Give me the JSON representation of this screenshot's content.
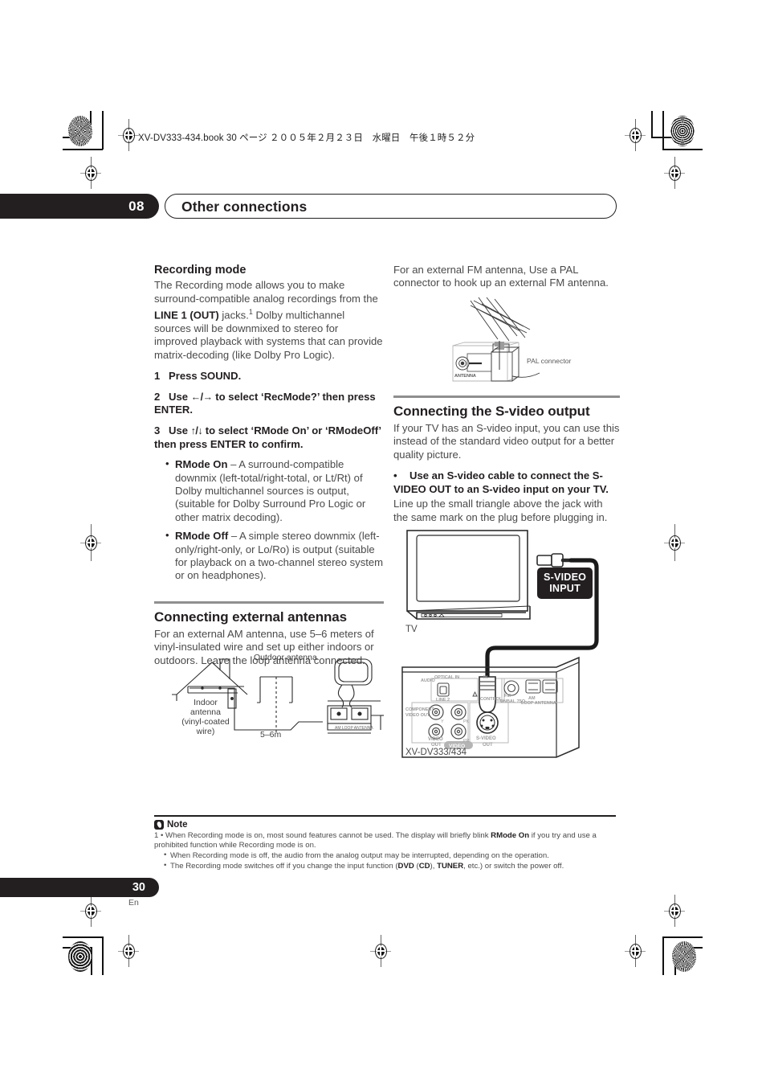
{
  "document": {
    "file_header": "XV-DV333-434.book  30 ページ  ２００５年２月２３日　水曜日　午後１時５２分",
    "chapter_number": "08",
    "chapter_title": "Other connections",
    "page_number": "30",
    "page_language": "En"
  },
  "left_column": {
    "recording_mode": {
      "heading": "Recording mode",
      "intro_1": "The Recording mode allows you to make surround-compatible analog recordings from the ",
      "intro_bold": "LINE 1 (OUT)",
      "intro_2": " jacks.",
      "intro_footnote": "1",
      "intro_3": " Dolby multichannel sources will be downmixed to stereo for improved playback with systems that can provide matrix-decoding (like Dolby Pro Logic).",
      "step1_num": "1",
      "step1_text": "Press SOUND.",
      "step2_num": "2",
      "step2_text_a": "Use ",
      "step2_arrows": "←/→",
      "step2_text_b": " to select ‘RecMode?’ then press ENTER.",
      "step3_num": "3",
      "step3_text_a": "Use ",
      "step3_arrows": "↑/↓",
      "step3_text_b": " to select ‘RMode On’ or ‘RModeOff’ then press ENTER to confirm.",
      "bullets": [
        {
          "term": "RMode On",
          "desc": " – A surround-compatible downmix (left-total/right-total, or Lt/Rt) of Dolby multichannel sources is output, (suitable for Dolby Surround Pro Logic or other matrix decoding)."
        },
        {
          "term": "RMode Off",
          "desc": " – A simple stereo downmix (left-only/right-only, or Lo/Ro) is output (suitable for playback on a two-channel stereo system or on headphones)."
        }
      ]
    },
    "external_antennas": {
      "heading": "Connecting external antennas",
      "body": "For an external AM antenna, use 5–6 meters of vinyl-insulated wire and set up either indoors or outdoors. Leave the loop antenna connected.",
      "figure": {
        "label_outdoor": "Outdoor antenna",
        "label_indoor": "Indoor antenna (vinyl-coated wire)",
        "label_length": "5–6m"
      }
    }
  },
  "right_column": {
    "fm_antenna": {
      "body": "For an external FM antenna, Use a PAL connector to hook up an external FM antenna.",
      "figure": {
        "label_pal": "PAL connector",
        "label_antenna_jack": "ANTENNA"
      }
    },
    "s_video": {
      "heading": "Connecting the S-video output",
      "body": "If your TV has an S-video input, you can use this instead of the standard video output for a better quality picture.",
      "bullet_bold": "Use an S-video cable to connect the S-VIDEO OUT to an S-video input on your TV.",
      "bullet_rest": "Line up the small triangle above the jack with the same mark on the plug before plugging in.",
      "figure": {
        "badge_line1": "S-VIDEO",
        "badge_line2": "INPUT",
        "label_tv": "TV",
        "label_model": "XV-DV333/434",
        "rear_labels": {
          "audio": "AUDIO",
          "optical_in": "OPTICAL IN",
          "line2": "LINE 2",
          "in": "IN",
          "control": "CONTROL",
          "component_video_out": "COMPONENT VIDEO OUT",
          "y": "Y",
          "pb": "Pв",
          "pr": "Pᴿ",
          "video_out": "VIDEO OUT",
          "video": "VIDEO",
          "s_video_out_l1": "S-VIDEO",
          "s_video_out_l2": "OUT",
          "fm_unbal": "FM UNBAL 75Ω",
          "am_loop_antenna": "AM LOOP ANTENNA"
        }
      }
    }
  },
  "note": {
    "label": "Note",
    "footnote_marker": "1",
    "items": [
      {
        "text_a": "When Recording mode is on, most sound features cannot be used. The display will briefly blink ",
        "bold": "RMode On",
        "text_b": " if you try and use a prohibited function while Recording mode is on."
      },
      {
        "text_a": "When Recording mode is off, the audio from the analog output may be interrupted, depending on the operation.",
        "bold": "",
        "text_b": ""
      },
      {
        "text_a": "The Recording mode switches off if you change the input function (",
        "bold": "DVD",
        "text_b": " (",
        "bold2": "CD",
        "text_c": "), ",
        "bold3": "TUNER",
        "text_d": ", etc.) or switch the power off."
      }
    ]
  },
  "colors": {
    "ink_black": "#231f20",
    "body_gray": "#4a4a4a",
    "rule_gray": "#8f8f8f"
  }
}
